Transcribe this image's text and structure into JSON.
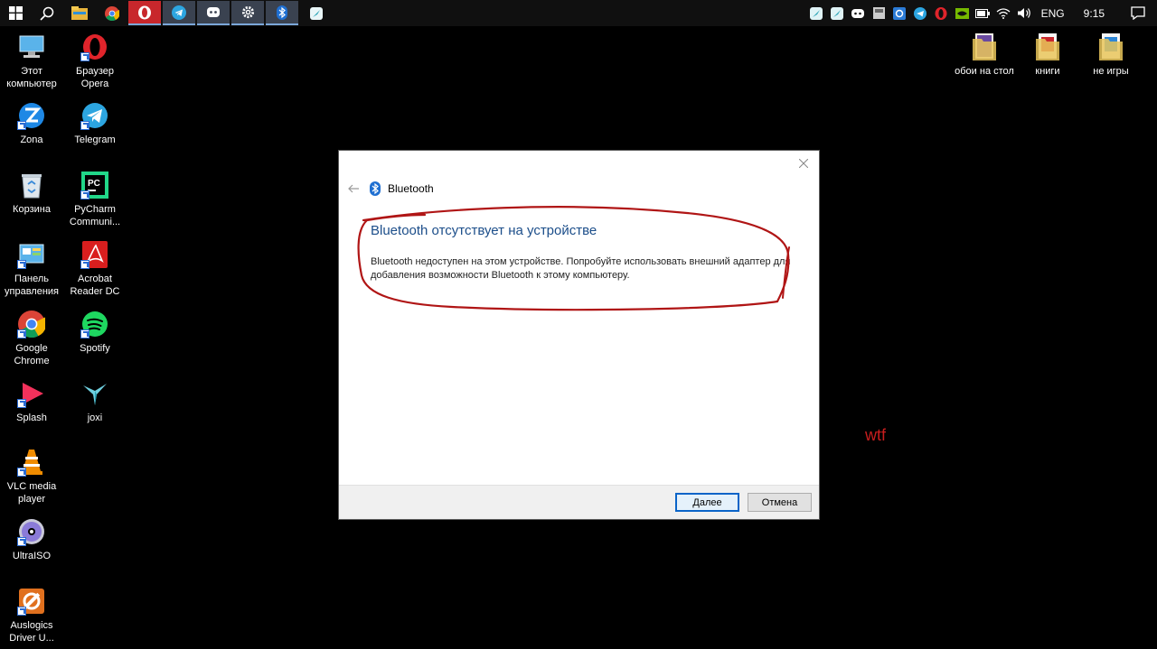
{
  "taskbar": {
    "language": "ENG",
    "clock": "9:15"
  },
  "desktop_left": [
    {
      "label": "Этот компьютер",
      "icon": "computer-icon"
    },
    {
      "label": "Браузер Opera",
      "icon": "opera-icon"
    },
    {
      "label": "Zona",
      "icon": "zona-icon"
    },
    {
      "label": "Telegram",
      "icon": "telegram-icon"
    },
    {
      "label": "Корзина",
      "icon": "recycle-bin-icon"
    },
    {
      "label": "PyCharm Communi...",
      "icon": "pycharm-icon"
    },
    {
      "label": "Панель управления",
      "icon": "control-panel-icon"
    },
    {
      "label": "Acrobat Reader DC",
      "icon": "acrobat-icon"
    },
    {
      "label": "Google Chrome",
      "icon": "chrome-icon"
    },
    {
      "label": "Spotify",
      "icon": "spotify-icon"
    },
    {
      "label": "Splash",
      "icon": "splash-icon"
    },
    {
      "label": "joxi",
      "icon": "joxi-icon"
    },
    {
      "label": "VLC media player",
      "icon": "vlc-icon"
    },
    {
      "label": "UltraISO",
      "icon": "ultraiso-icon"
    },
    {
      "label": "Auslogics Driver U...",
      "icon": "auslogics-icon"
    }
  ],
  "desktop_right": [
    {
      "label": "обои на стол",
      "icon": "folder-icon"
    },
    {
      "label": "книги",
      "icon": "folder-icon"
    },
    {
      "label": "не игры",
      "icon": "folder-icon"
    }
  ],
  "dialog": {
    "title": "Bluetooth",
    "heading": "Bluetooth отсутствует на устройстве",
    "body": "Bluetooth недоступен на этом устройстве. Попробуйте использовать внешний адаптер для добавления возможности Bluetooth к этому компьютеру.",
    "next_label": "Далее",
    "cancel_label": "Отмена"
  },
  "annotation": {
    "text": "wtf",
    "color": "#c81e1e"
  },
  "colors": {
    "heading": "#1c4e8a",
    "taskbar": "#101010",
    "primary_button_border": "#0a64c8"
  }
}
